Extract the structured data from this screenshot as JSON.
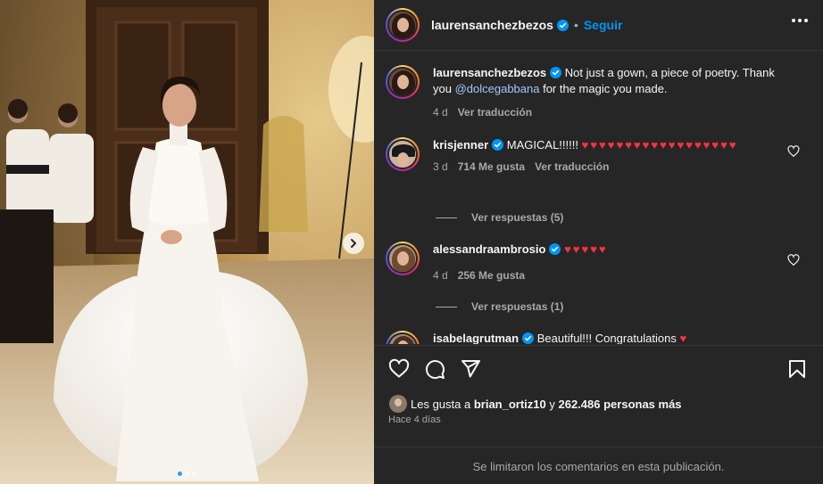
{
  "post": {
    "author": "laurensanchezbezos",
    "separator": "•",
    "follow_label": "Seguir",
    "caption": {
      "username": "laurensanchezbezos",
      "text_before": "Not just a gown, a piece of poetry. Thank you ",
      "mention": "@dolcegabbana",
      "text_after": " for the magic you made.",
      "age": "4 d",
      "translate_label": "Ver traducción"
    },
    "comments": [
      {
        "username": "krisjenner",
        "text": "MAGICAL!!!!!!",
        "emojis": "♥♥♥♥♥♥♥♥♥♥♥♥♥♥♥♥♥♥",
        "age": "3 d",
        "likes": "714 Me gusta",
        "translate_label": "Ver traducción",
        "replies_label": "Ver respuestas (5)"
      },
      {
        "username": "alessandraambrosio",
        "text": "",
        "emojis": "♥♥♥♥♥",
        "age": "4 d",
        "likes": "256 Me gusta",
        "replies_label": "Ver respuestas (1)"
      },
      {
        "username": "isabelagrutman",
        "text": "Beautiful!!! Congratulations",
        "emojis": "♥"
      }
    ],
    "likes": {
      "prefix": "Les gusta a ",
      "user": "brian_ortiz10",
      "middle": " y ",
      "count": "262.486 personas más"
    },
    "posted": "Hace 4 días",
    "comments_limited": "Se limitaron los comentarios en esta publicación.",
    "carousel": {
      "total_slides": 3,
      "active_slide": 1
    }
  },
  "icons": {
    "verified": "verified-badge-icon",
    "more": "more-options-icon",
    "like": "heart-icon",
    "comment": "comment-icon",
    "share": "send-icon",
    "save": "bookmark-icon",
    "next": "chevron-right-icon"
  },
  "colors": {
    "background": "#262626",
    "accent": "#0095f6",
    "muted": "#a8a8a8",
    "heart": "#ff3040"
  }
}
